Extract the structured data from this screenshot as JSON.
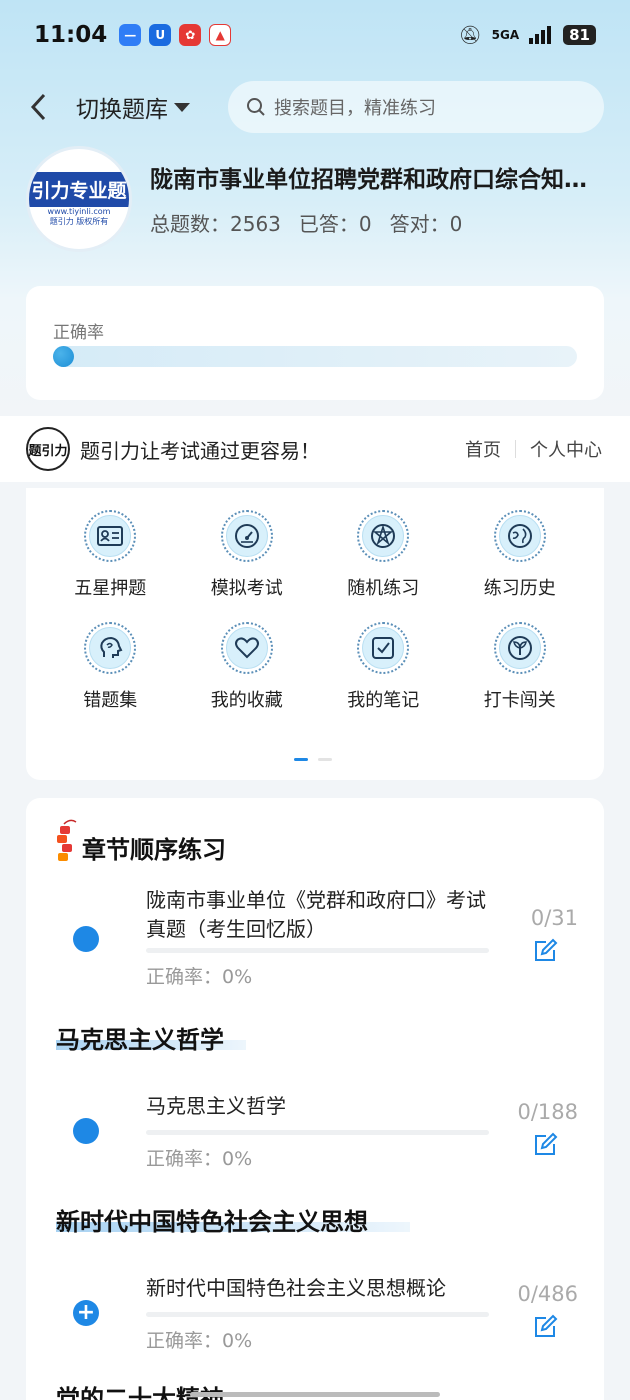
{
  "status_bar": {
    "time": "11:04",
    "network": "5GA",
    "battery": "81"
  },
  "nav": {
    "back_symbol": "‹",
    "switch_label": "切换题库",
    "search_placeholder": "搜索题目，精准练习"
  },
  "bank": {
    "logo_title": "引力专业题",
    "logo_url": "www.tiyinli.com",
    "logo_footer": "题引力 版权所有",
    "title": "陇南市事业单位招聘党群和政府口综合知识题库",
    "total_label": "总题数：",
    "total": "2563",
    "answered_label": "已答：",
    "answered": "0",
    "correct_label": "答对：",
    "correct": "0"
  },
  "accuracy": {
    "label": "正确率",
    "value": 0
  },
  "banner": {
    "logo_text": "题引力",
    "slogan": "题引力让考试通过更容易！",
    "home": "首页",
    "profile": "个人中心"
  },
  "grid": [
    {
      "label": "五星押题",
      "icon": "id-card-icon"
    },
    {
      "label": "模拟考试",
      "icon": "gauge-icon"
    },
    {
      "label": "随机练习",
      "icon": "network-icon"
    },
    {
      "label": "练习历史",
      "icon": "globe-icon"
    },
    {
      "label": "错题集",
      "icon": "head-icon"
    },
    {
      "label": "我的收藏",
      "icon": "heart-icon"
    },
    {
      "label": "我的笔记",
      "icon": "note-check-icon"
    },
    {
      "label": "打卡闯关",
      "icon": "sprout-icon"
    }
  ],
  "chapters": {
    "title": "章节顺序练习",
    "sections": [
      {
        "heading": "",
        "item": {
          "name": "陇南市事业单位《党群和政府口》考试真题（考生回忆版）",
          "accuracy": "正确率：0%",
          "count": "0/31",
          "marker": "dot"
        }
      },
      {
        "heading": "马克思主义哲学",
        "item": {
          "name": "马克思主义哲学",
          "accuracy": "正确率：0%",
          "count": "0/188",
          "marker": "dot"
        }
      },
      {
        "heading": "新时代中国特色社会主义思想",
        "item": {
          "name": "新时代中国特色社会主义思想概论",
          "accuracy": "正确率：0%",
          "count": "0/486",
          "marker": "plus"
        }
      },
      {
        "heading": "党的二十大精神",
        "item": null
      }
    ]
  },
  "colors": {
    "accent": "#1e88e5",
    "brand": "#1f4aa8",
    "bg_top": "#bfe4f5"
  }
}
